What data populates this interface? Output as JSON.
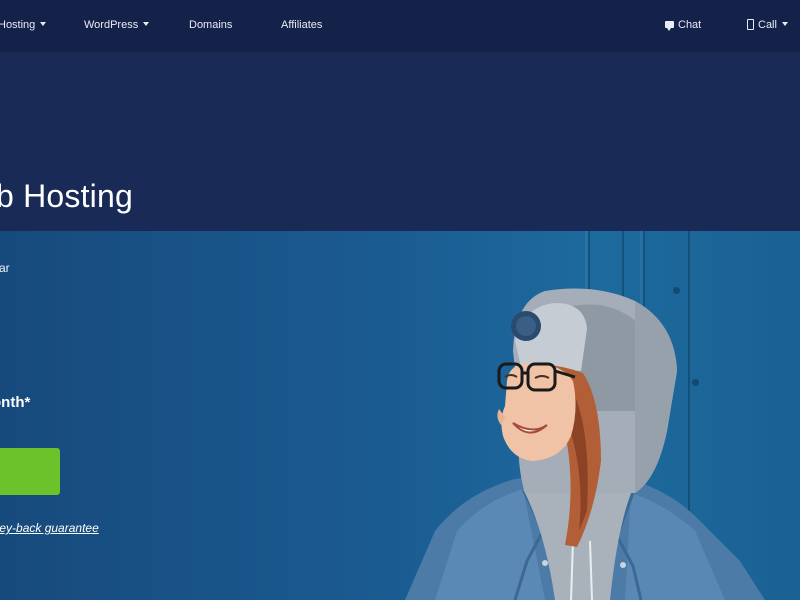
{
  "nav": {
    "items": [
      {
        "label": "Hosting",
        "has_dropdown": true
      },
      {
        "label": "WordPress",
        "has_dropdown": true
      },
      {
        "label": "Domains",
        "has_dropdown": false
      },
      {
        "label": "Affiliates",
        "has_dropdown": false
      }
    ],
    "chat": {
      "label": "Chat",
      "icon": "chat-bubble-icon"
    },
    "call": {
      "label": "Call",
      "icon": "phone-icon",
      "has_dropdown": true
    }
  },
  "hero": {
    "headline": "eb Hosting",
    "fragment_text": "ar",
    "price_text": "onth*",
    "cta_label": "",
    "guarantee_text": "oney-back guarantee"
  },
  "colors": {
    "nav_background": "#14224a",
    "header_background": "#182a55",
    "hero_blue": "#1a5a90",
    "cta_green": "#6bc22a",
    "text": "#ffffff"
  }
}
